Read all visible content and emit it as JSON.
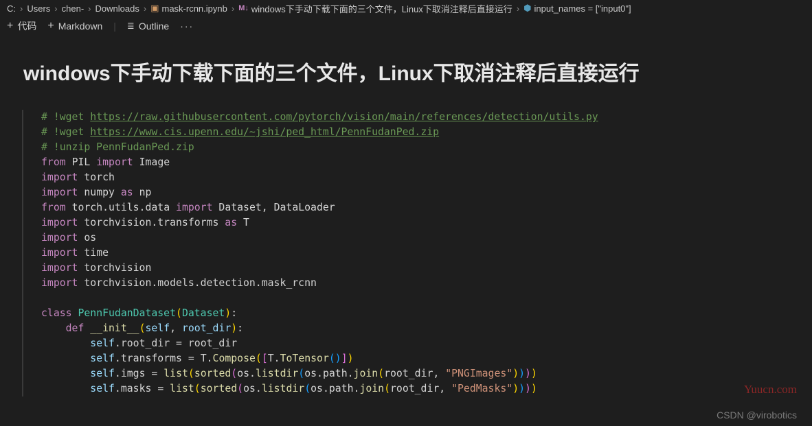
{
  "breadcrumb": {
    "items": [
      "C:",
      "Users",
      "chen-",
      "Downloads"
    ],
    "file": "mask-rcnn.ipynb",
    "cell": "windows下手动下载下面的三个文件，Linux下取消注释后直接运行",
    "symbol": "input_names = [\"input0\"]"
  },
  "toolbar": {
    "code": "代码",
    "markdown": "Markdown",
    "outline": "Outline",
    "more": "···"
  },
  "heading": "windows下手动下载下面的三个文件，Linux下取消注释后直接运行",
  "code": {
    "c1": "# !wget ",
    "u1": "https://raw.githubusercontent.com/pytorch/vision/main/references/detection/utils.py",
    "c2": "# !wget ",
    "u2": "https://www.cis.upenn.edu/~jshi/ped_html/PennFudanPed.zip",
    "c3": "# !unzip PennFudanPed.zip",
    "l4_from": "from",
    "l4_pil": "PIL",
    "l4_import": "import",
    "l4_image": "Image",
    "l5_import": "import",
    "l5_torch": "torch",
    "l6_import": "import",
    "l6_numpy": "numpy",
    "l6_as": "as",
    "l6_np": "np",
    "l7_from": "from",
    "l7_mod": "torch.utils.data",
    "l7_import": "import",
    "l7_ds": "Dataset",
    "l7_dl": "DataLoader",
    "l8_import": "import",
    "l8_mod": "torchvision.transforms",
    "l8_as": "as",
    "l8_T": "T",
    "l9_import": "import",
    "l9_os": "os",
    "l10_import": "import",
    "l10_time": "time",
    "l11_import": "import",
    "l11_tv": "torchvision",
    "l12_import": "import",
    "l12_mod": "torchvision.models.detection.mask_rcnn",
    "cls_kw": "class",
    "cls_name": "PennFudanDataset",
    "cls_base": "Dataset",
    "def_kw": "def",
    "init": "__init__",
    "self": "self",
    "root": "root_dir",
    "assign_root": "root_dir",
    "transforms": "transforms",
    "compose": "Compose",
    "totensor": "ToTensor",
    "T": "T",
    "imgs": "imgs",
    "list": "list",
    "sorted": "sorted",
    "listdir": "listdir",
    "join": "join",
    "os": "os",
    "path": "path",
    "png": "\"PNGImages\"",
    "masks": "masks",
    "ped": "\"PedMasks\""
  },
  "watermark1": "Yuucn.com",
  "watermark2": "CSDN @virobotics"
}
